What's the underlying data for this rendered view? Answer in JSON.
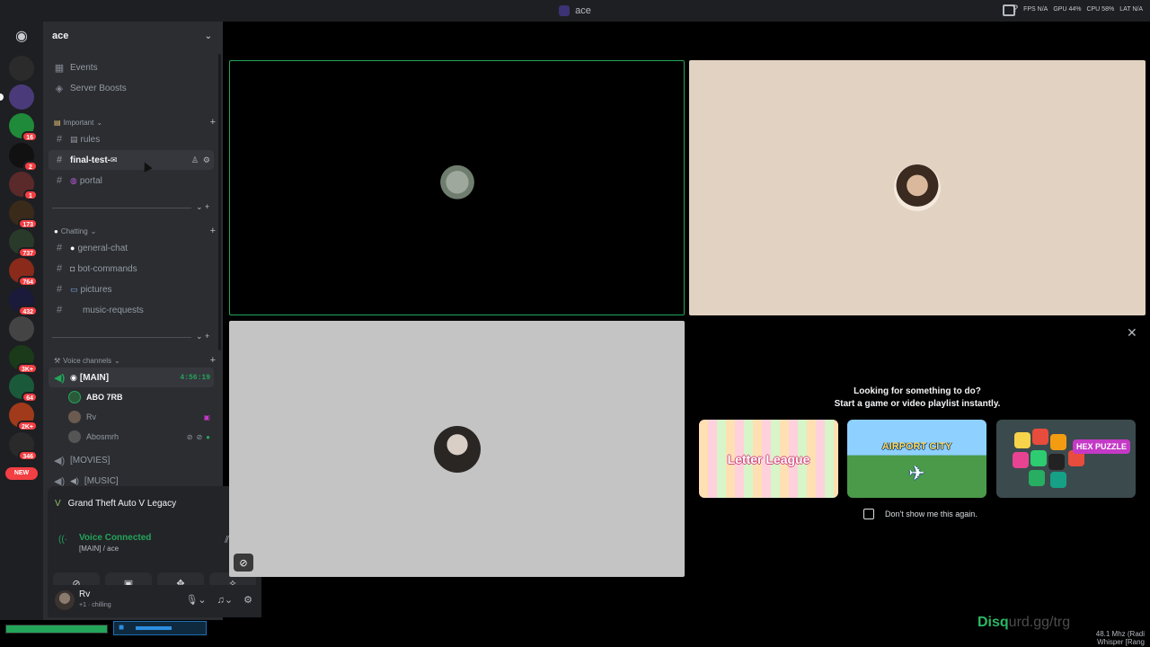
{
  "window": {
    "title": "ace"
  },
  "titlebar_stats": [
    "FPS N/A",
    "GPU 44%",
    "CPU 58%",
    "LAT N/A"
  ],
  "guild": {
    "name": "ace"
  },
  "servers": [
    {
      "badge": ""
    },
    {
      "badge": ""
    },
    {
      "badge": "16"
    },
    {
      "badge": "2"
    },
    {
      "badge": "1"
    },
    {
      "badge": "173"
    },
    {
      "badge": "737"
    },
    {
      "badge": "764"
    },
    {
      "badge": "432"
    },
    {
      "badge": ""
    },
    {
      "badge": "3K+"
    },
    {
      "badge": "64"
    },
    {
      "badge": "2K+"
    },
    {
      "badge": "346"
    }
  ],
  "new_label": "NEW",
  "top_items": [
    {
      "icon": "calendar-icon",
      "label": "Events"
    },
    {
      "icon": "boost-icon",
      "label": "Server Boosts"
    }
  ],
  "categories": {
    "important": "Important",
    "chatting": "Chatting",
    "voice": "Voice channels"
  },
  "important_channels": [
    {
      "label": "rules"
    },
    {
      "label": "final-test-"
    },
    {
      "label": "portal"
    }
  ],
  "chatting_channels": [
    {
      "label": "general-chat"
    },
    {
      "label": "bot-commands"
    },
    {
      "label": "pictures"
    },
    {
      "label": "music-requests"
    }
  ],
  "voice_channels": {
    "main": {
      "label": "[MAIN]",
      "timer": "4:56:19"
    },
    "users": [
      {
        "name": "ABO 7RB"
      },
      {
        "name": "Rv"
      },
      {
        "name": "Abosmrh"
      }
    ],
    "others": [
      {
        "label": "[MOVIES]"
      },
      {
        "label": "[MUSIC]"
      }
    ]
  },
  "activity": {
    "game": "Grand Theft Auto V Legacy"
  },
  "voice_panel": {
    "status": "Voice Connected",
    "location": "[MAIN] / ace"
  },
  "user": {
    "name": "Rv",
    "status": "+1 · chilling"
  },
  "promo": {
    "line1": "Looking for something to do?",
    "line2": "Start a game or video playlist instantly.",
    "cards": [
      "Letter League",
      "AIRPORT CITY",
      "HEX PUZZLE"
    ],
    "dont_show": "Don't show me this again."
  },
  "watermark": {
    "bright": "Disq",
    "dim": "urd.gg/trg"
  },
  "freq": {
    "line1": "48.1 Mhz (Radi",
    "line2": "Whisper [Rang"
  },
  "meters": {
    "green_level": 1.0,
    "blue_level": 0.55
  },
  "colors": {
    "accent_green": "#23a55a",
    "badge_red": "#f23f43",
    "sidebar": "#2b2d31",
    "rail": "#1e1f22"
  }
}
